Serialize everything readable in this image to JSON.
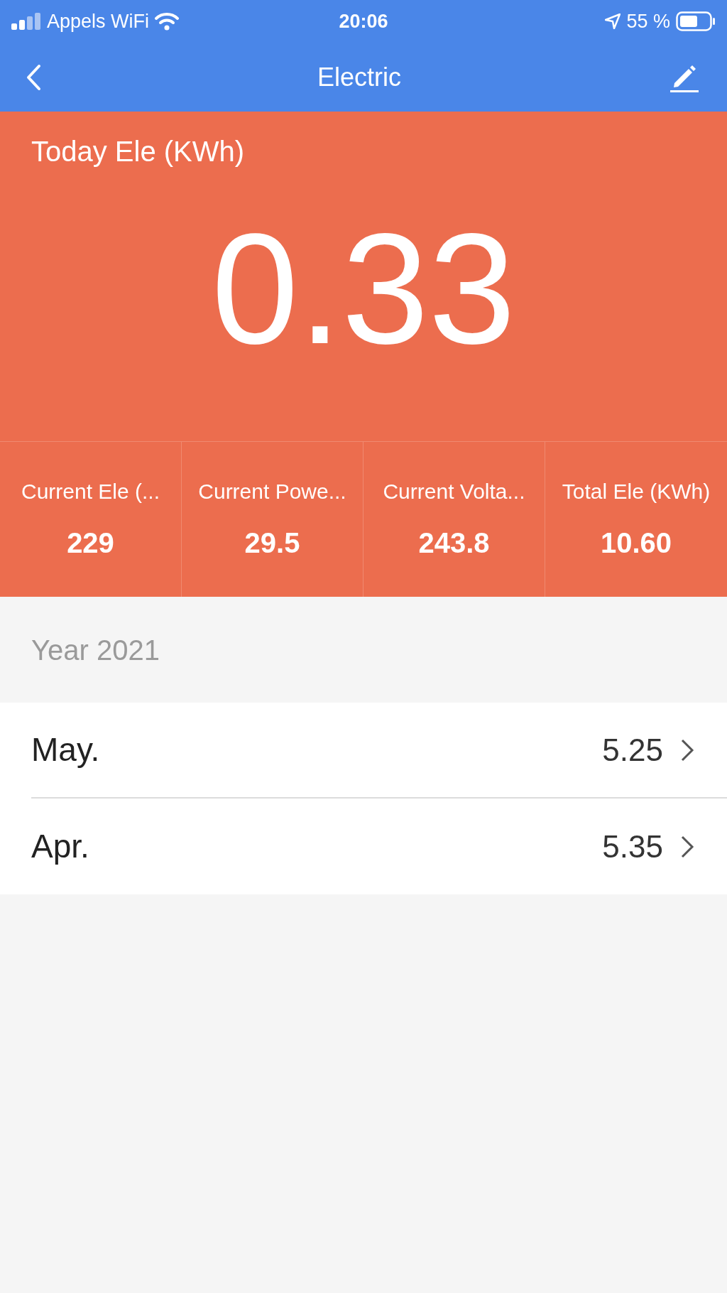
{
  "status_bar": {
    "carrier": "Appels WiFi",
    "time": "20:06",
    "battery": "55 %"
  },
  "nav_bar": {
    "title": "Electric"
  },
  "today": {
    "label": "Today Ele (KWh)",
    "value": "0.33"
  },
  "stats": [
    {
      "label": "Current Ele (...",
      "value": "229"
    },
    {
      "label": "Current Powe...",
      "value": "29.5"
    },
    {
      "label": "Current Volta...",
      "value": "243.8"
    },
    {
      "label": "Total Ele (KWh)",
      "value": "10.60"
    }
  ],
  "section": {
    "title": "Year 2021"
  },
  "months": [
    {
      "label": "May.",
      "value": "5.25"
    },
    {
      "label": "Apr.",
      "value": "5.35"
    }
  ]
}
